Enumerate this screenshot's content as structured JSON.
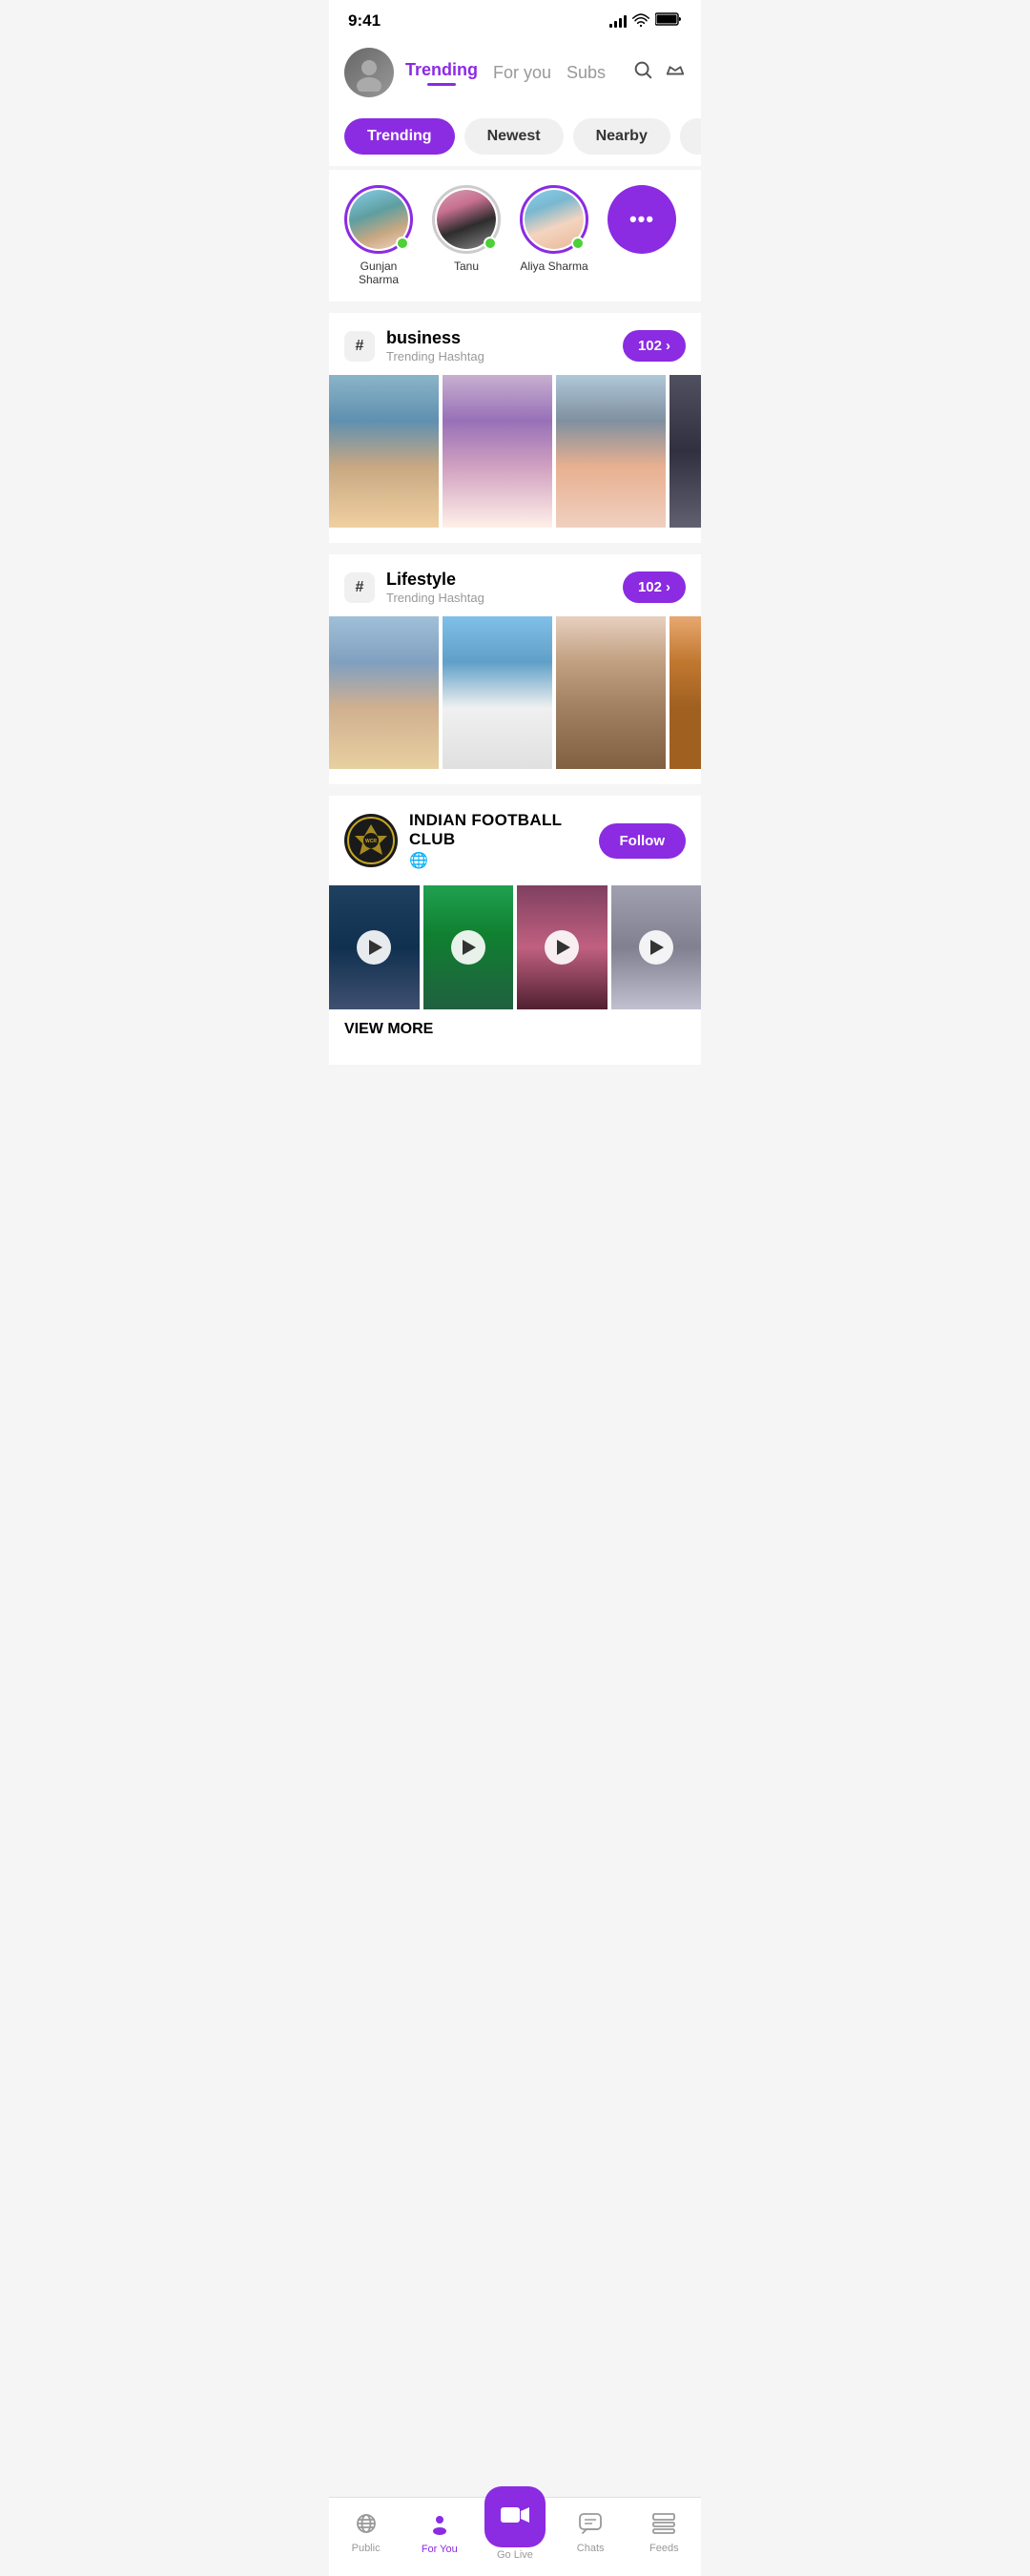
{
  "statusBar": {
    "time": "9:41",
    "signalBars": [
      4,
      7,
      10,
      13
    ],
    "wifiSymbol": "wifi",
    "batterySymbol": "battery"
  },
  "header": {
    "trendingLabel": "Trending",
    "forYouLabel": "For you",
    "subsLabel": "Subs",
    "searchIcon": "search",
    "crownIcon": "crown"
  },
  "filterTabs": [
    {
      "label": "Trending",
      "active": true
    },
    {
      "label": "Newest",
      "active": false
    },
    {
      "label": "Nearby",
      "active": false
    }
  ],
  "stories": [
    {
      "name": "Gunjan Sharma",
      "online": true
    },
    {
      "name": "Tanu",
      "online": true
    },
    {
      "name": "Aliya Sharma",
      "online": true
    },
    {
      "name": "More",
      "isMore": true
    }
  ],
  "businessSection": {
    "hashLabel": "#",
    "title": "business",
    "subtitle": "Trending Hashtag",
    "count": "102",
    "chevron": "›"
  },
  "lifestyleSection": {
    "hashLabel": "#",
    "title": "Lifestyle",
    "subtitle": "Trending Hashtag",
    "count": "102",
    "chevron": "›"
  },
  "clubSection": {
    "clubName": "INDIAN FOOTBALL CLUB",
    "globeIcon": "🌐",
    "followLabel": "Follow",
    "viewMoreLabel": "VIEW MORE"
  },
  "bottomNav": {
    "publicLabel": "Public",
    "forYouLabel": "For You",
    "goLiveLabel": "Go Live",
    "chatsLabel": "Chats",
    "feedsLabel": "Feeds"
  },
  "colors": {
    "primary": "#8B2BE2",
    "online": "#4CD137",
    "inactive": "#999999",
    "text": "#000000",
    "subtext": "#999999"
  }
}
